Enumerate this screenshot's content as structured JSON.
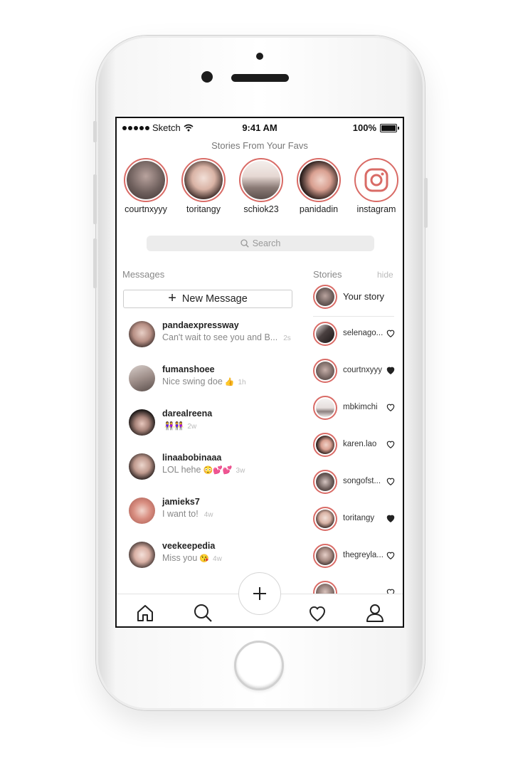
{
  "status_bar": {
    "carrier": "Sketch",
    "time": "9:41 AM",
    "battery": "100%"
  },
  "favorites": {
    "title": "Stories From Your Favs",
    "items": [
      {
        "name": "courtnxyyy"
      },
      {
        "name": "toritangy"
      },
      {
        "name": "schiok23"
      },
      {
        "name": "panidadin"
      },
      {
        "name": "instagram",
        "icon": "instagram-logo-icon"
      }
    ]
  },
  "search": {
    "placeholder": "Search",
    "icon": "search-icon"
  },
  "messages": {
    "title": "Messages",
    "new_message_label": "New Message",
    "threads": [
      {
        "name": "pandaexpressway",
        "preview": "Can't wait to see you and B...",
        "emoji": "",
        "age": "2s"
      },
      {
        "name": "fumanshoee",
        "preview": "Nice swing doe",
        "emoji": "👍",
        "age": "1h"
      },
      {
        "name": "darealreena",
        "preview": "",
        "emoji": "👭👭",
        "age": "2w"
      },
      {
        "name": "linaabobinaaa",
        "preview": "LOL hehe",
        "emoji": "😳💕💕",
        "age": "3w"
      },
      {
        "name": "jamieks7",
        "preview": "I want to!",
        "emoji": "",
        "age": "4w"
      },
      {
        "name": "veekeepedia",
        "preview": "Miss you",
        "emoji": "😘",
        "age": "4w"
      }
    ]
  },
  "stories": {
    "title": "Stories",
    "hide_label": "hide",
    "your_story_label": "Your story",
    "items": [
      {
        "name": "selenago...",
        "liked": false
      },
      {
        "name": "courtnxyyy",
        "liked": true
      },
      {
        "name": "mbkimchi",
        "liked": false
      },
      {
        "name": "karen.lao",
        "liked": false
      },
      {
        "name": "songofst...",
        "liked": false
      },
      {
        "name": "toritangy",
        "liked": true
      },
      {
        "name": "thegreyla...",
        "liked": false
      },
      {
        "name": "",
        "liked": false
      }
    ]
  },
  "tab_bar": {
    "icons": [
      "home-icon",
      "search-icon",
      "compose-plus-icon",
      "heart-icon",
      "profile-icon"
    ]
  },
  "colors": {
    "accent": "#d96b66",
    "text": "#222222",
    "muted": "#888888",
    "search_bg": "#ececec"
  }
}
